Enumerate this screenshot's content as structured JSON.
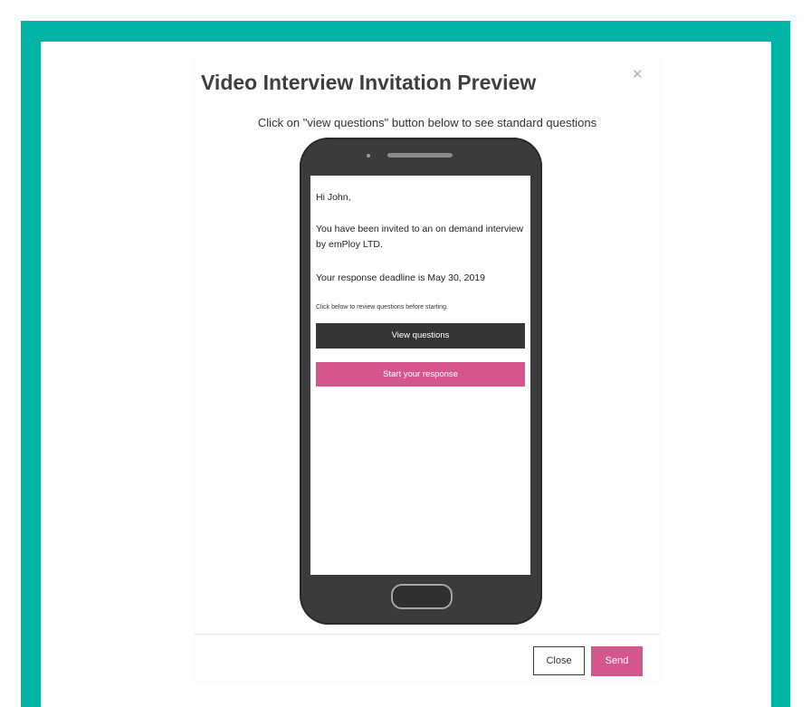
{
  "modal": {
    "title": "Video Interview Invitation Preview",
    "close_icon": "close-icon",
    "subtitle": "Click on \"view questions\" button below to see standard questions"
  },
  "email": {
    "greeting": "Hi John,",
    "invite_text": "You have been invited to an on demand interview by emPloy LTD.",
    "deadline_text": "Your response deadline is May 30, 2019",
    "note": "Click below to review questions before starting.",
    "view_questions_label": "View questions",
    "start_response_label": "Start your response"
  },
  "footer": {
    "close_label": "Close",
    "send_label": "Send"
  },
  "colors": {
    "accent_teal": "#00b5a5",
    "brand_pink": "#d5558f",
    "dark_button": "#353535",
    "phone_body": "#3b3b3b"
  }
}
